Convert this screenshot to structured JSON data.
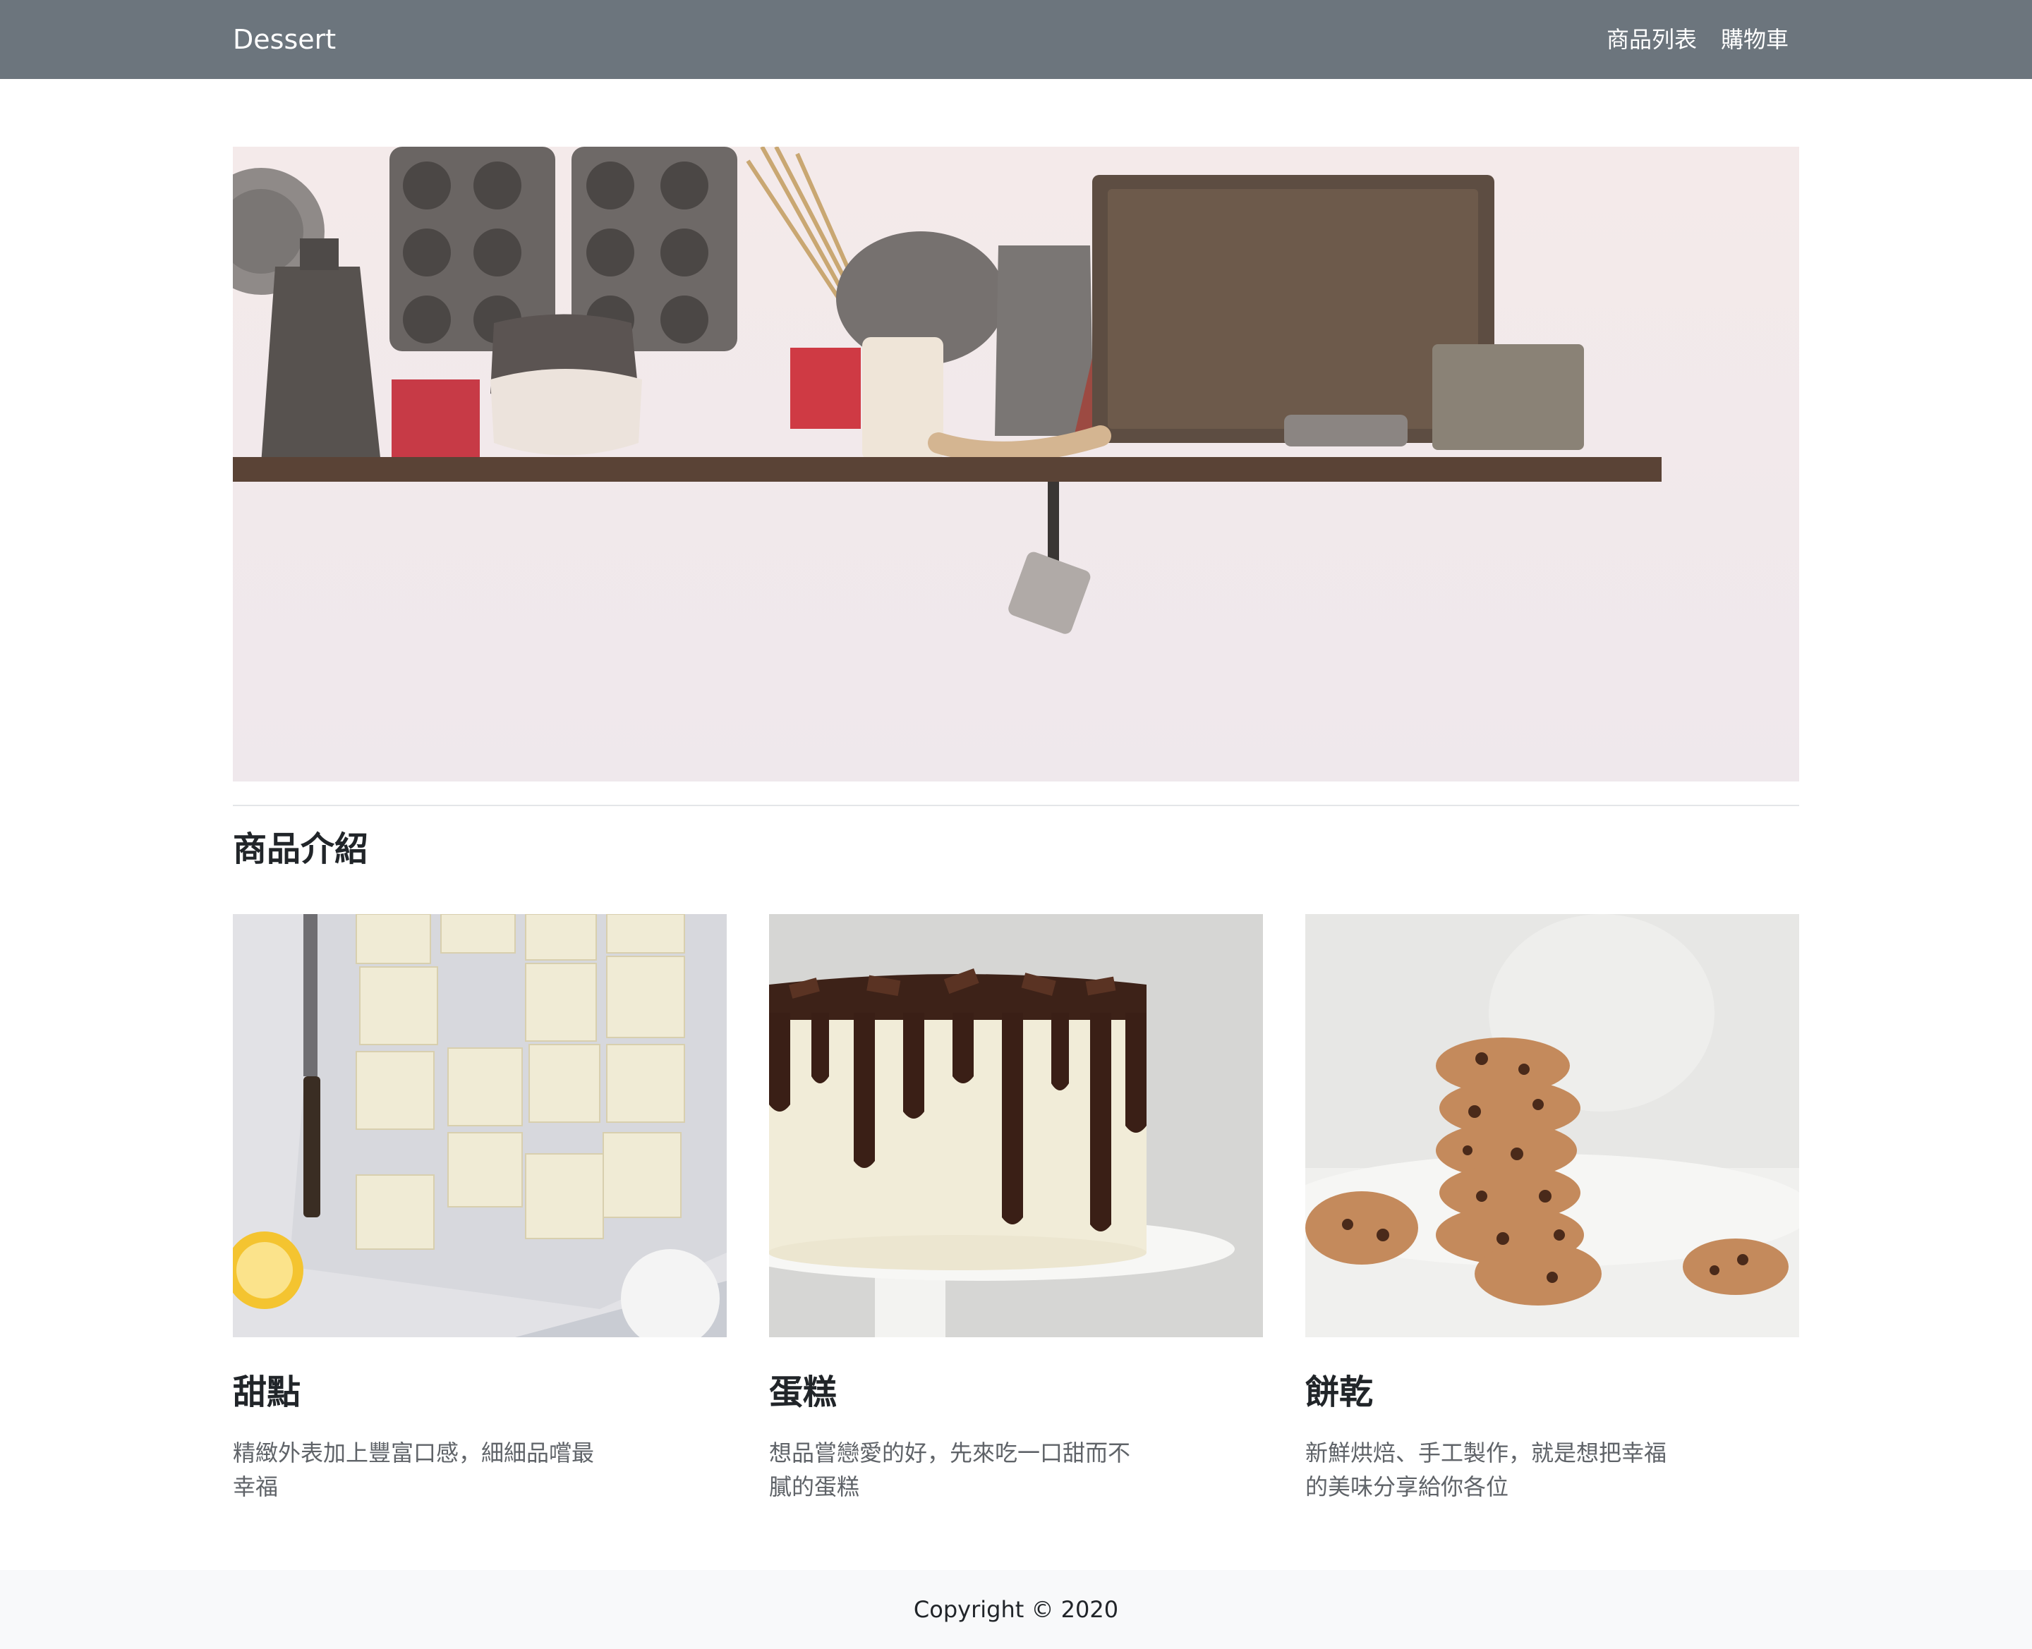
{
  "navbar": {
    "brand": "Dessert",
    "links": [
      {
        "label": "商品列表"
      },
      {
        "label": "購物車"
      }
    ]
  },
  "section": {
    "title": "商品介紹"
  },
  "cards": [
    {
      "title": "甜點",
      "text": "精緻外表加上豐富口感，細細品嚐最幸福"
    },
    {
      "title": "蛋糕",
      "text": "想品嘗戀愛的好，先來吃一口甜而不膩的蛋糕"
    },
    {
      "title": "餅乾",
      "text": "新鮮烘焙、手工製作，就是想把幸福的美味分享給你各位"
    }
  ],
  "footer": {
    "copyright": "Copyright © 2020"
  },
  "colors": {
    "navbar_bg": "#6c757d",
    "footer_bg": "#f8f9fa",
    "text_muted": "#5f6368"
  }
}
